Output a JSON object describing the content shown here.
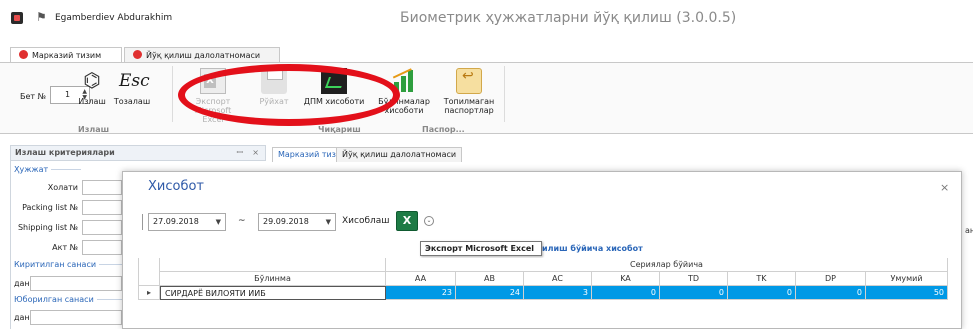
{
  "app": {
    "user": "Egamberdiev Abdurakhim",
    "title": "Биометрик ҳужжатларни йўқ қилиш (3.0.0.5)"
  },
  "ribbon_tabs": [
    {
      "label": "Марказий тизим",
      "active": true
    },
    {
      "label": "Йўқ қилиш далолатномаси",
      "active": false
    }
  ],
  "ribbon": {
    "page_label": "Бет №",
    "page_value": "1",
    "buttons": {
      "search": "Излаш",
      "clear": "Тозалаш",
      "export": "Экспорт",
      "export_2": "Microsoft Excel",
      "list": "Рўйхат",
      "dpm": "ДПМ хисоботи",
      "divisions": "Бўлинмалар хисоботи",
      "not_found": "Топилмаган паспортлар"
    },
    "groups": {
      "search": "Излаш",
      "output": "Чиқариш",
      "passport": "Паспор..."
    },
    "icons": [
      "binoculars-icon",
      "esc-icon",
      "excel-icon",
      "printer-icon",
      "dpm-chart-icon",
      "bar-chart-icon",
      "return-icon"
    ]
  },
  "left_panel": {
    "header": "Излаш критериялари",
    "pin": "ꟷ",
    "close": "×",
    "sections": {
      "document": "Ҳужжат",
      "entered_date": "Киритилган санаси",
      "sent_date": "Юборилган санаси"
    },
    "fields": {
      "status": "Холати",
      "packing": "Packing list №",
      "shipping": "Shipping list №",
      "act": "Акт №",
      "from_1": "дан",
      "from_2": "дан"
    }
  },
  "doc_tabs": [
    "Марказий тизим",
    "Йўқ қилиш далолатномаси"
  ],
  "dialog": {
    "title": "Хисобот",
    "close": "×",
    "date_from": "27.09.2018",
    "tilde": "~",
    "date_to": "29.09.2018",
    "calc_label": "Хисоблаш",
    "excel_label": "X",
    "tooltip": "Экспорт Microsoft Excel",
    "report_title": "илиш бўйича хисобот",
    "partial_right": "ан",
    "grid": {
      "group_header": "Сериялар бўйича",
      "division_header": "Бўлинма",
      "columns": [
        "AA",
        "AB",
        "AC",
        "KA",
        "TD",
        "TK",
        "DP",
        "Умумий"
      ],
      "rows": [
        {
          "indicator": "▸",
          "name": "СИРДАРЁ ВИЛОЯТИ ИИБ",
          "values": [
            "23",
            "24",
            "3",
            "0",
            "0",
            "0",
            "0",
            "50"
          ]
        }
      ]
    }
  },
  "colors": {
    "accent_blue": "#2a66b8",
    "selection": "#0099e6",
    "annotation_red": "#e3101a",
    "excel_green": "#1e7b45"
  }
}
